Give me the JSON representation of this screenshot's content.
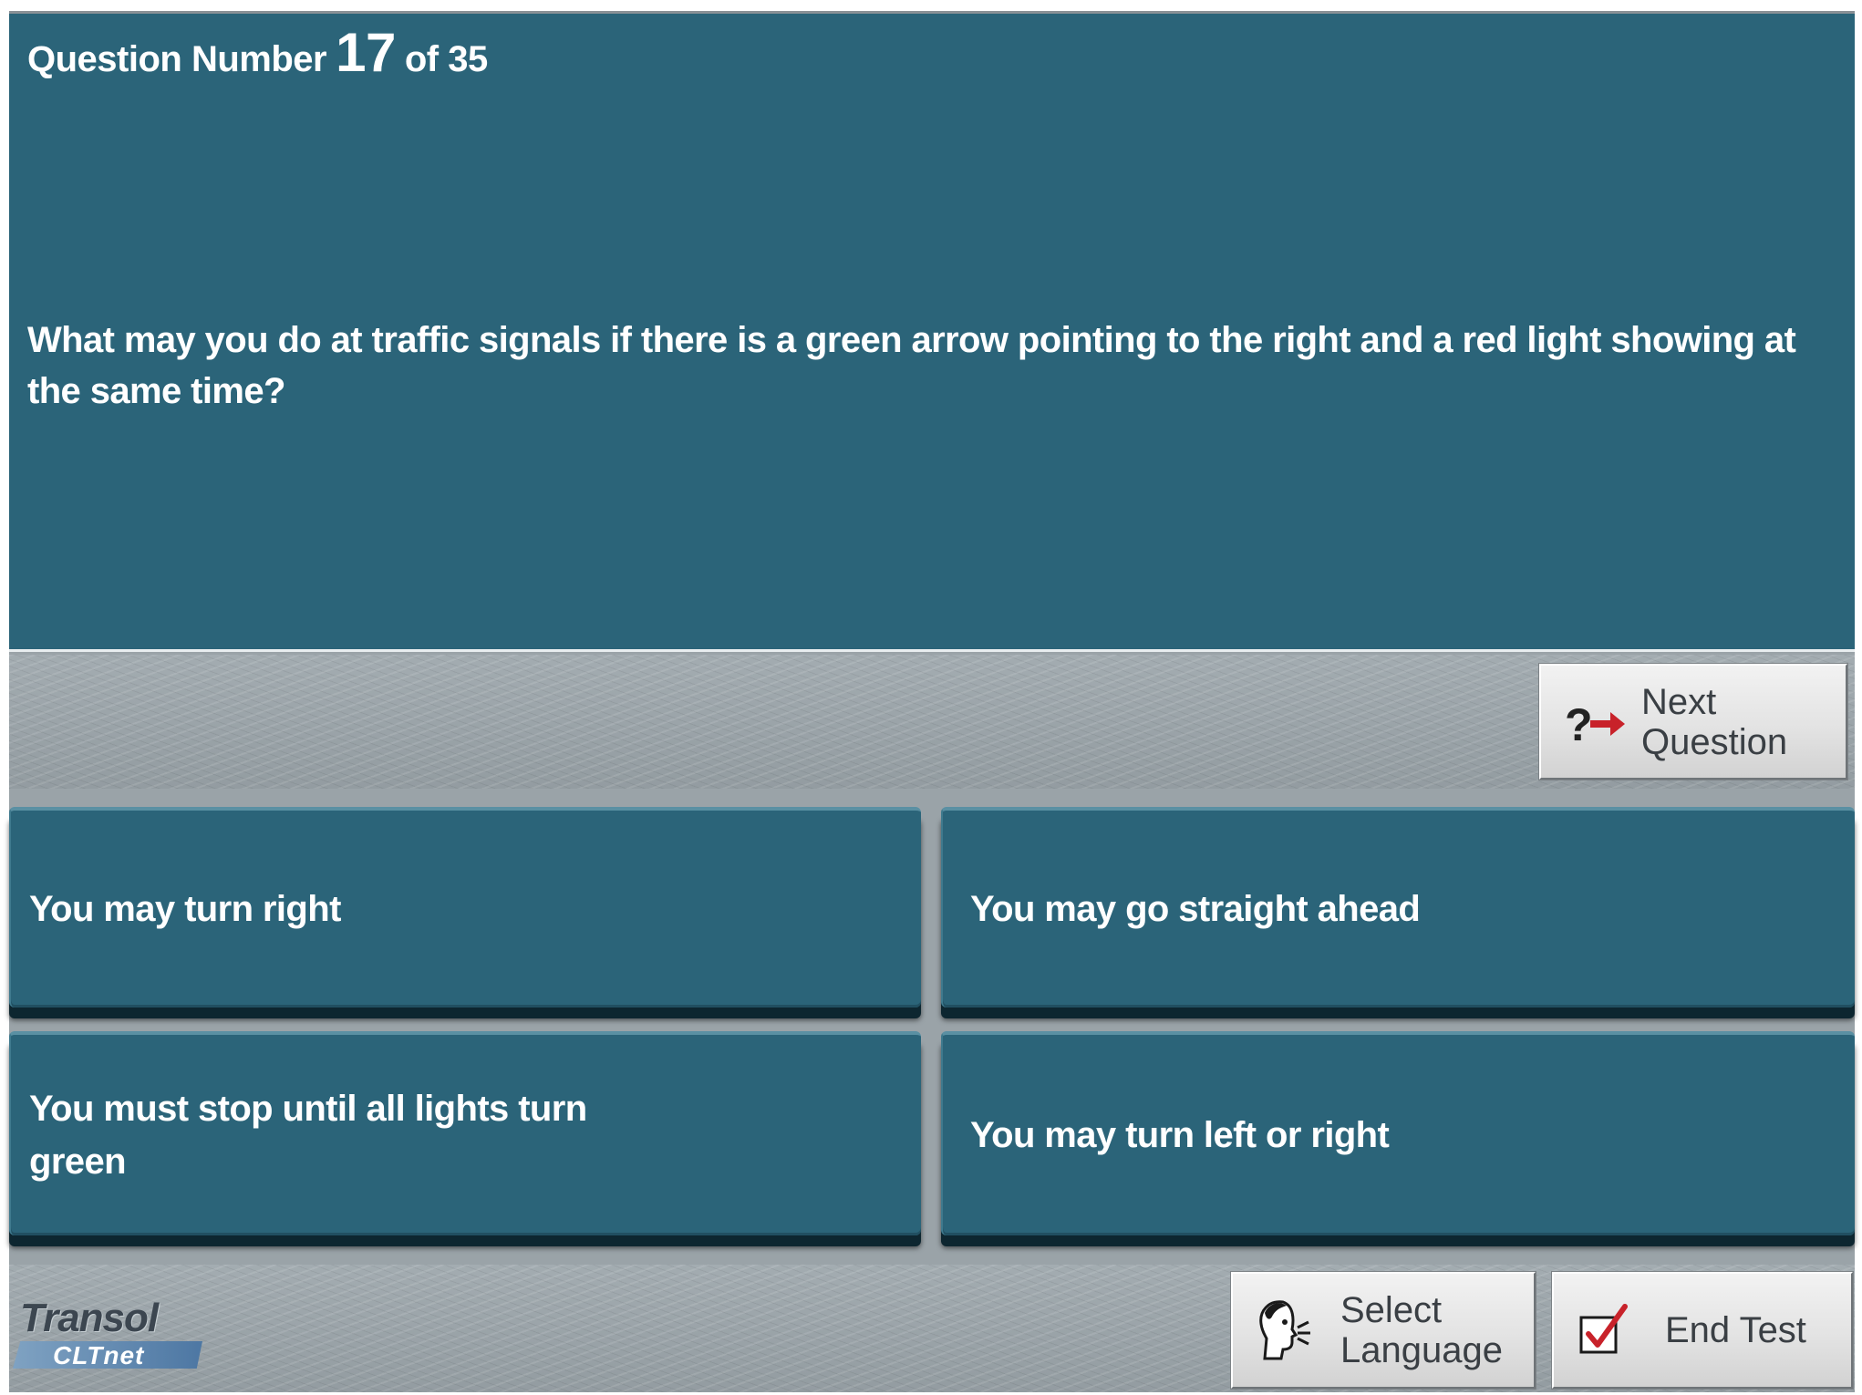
{
  "header": {
    "question_prefix": "Question Number",
    "question_number": "17",
    "question_suffix": "of 35"
  },
  "question": {
    "text": "What may you do at traffic signals if there is a green arrow pointing to the right and a red light showing at the same time?"
  },
  "next_button": {
    "line1": "Next",
    "line2": "Question",
    "icon": "question-arrow-icon"
  },
  "answers": [
    {
      "text": "You may turn right"
    },
    {
      "text": "You may go straight ahead"
    },
    {
      "text": "You must stop until all lights turn green"
    },
    {
      "text": "You may turn left or right"
    }
  ],
  "footer": {
    "logo_main": "Transol",
    "logo_sub": "CLTnet",
    "select_language": {
      "line1": "Select",
      "line2": "Language",
      "icon": "speaking-head-icon"
    },
    "end_test": {
      "label": "End Test",
      "icon": "checkbox-check-icon"
    }
  },
  "colors": {
    "panel": "#2b6479",
    "answer_shadow": "#0d2630",
    "button_face": "#e3e3e3",
    "arrow_red": "#c8222a"
  }
}
